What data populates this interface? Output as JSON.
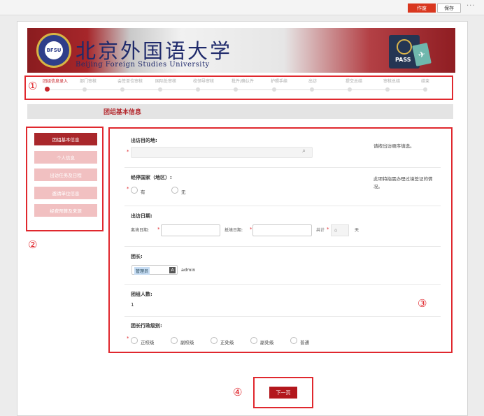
{
  "toolbar": {
    "draft": "作废",
    "save": "保存",
    "more": "···"
  },
  "banner": {
    "name_cn": "北京外国语大学",
    "name_en": "Beijing Foreign Studies University",
    "seal_text": "BFSU",
    "passport_label": "PASS",
    "ticket_glyph": "✈"
  },
  "steps": [
    {
      "label": "团组信息录入",
      "active": true
    },
    {
      "label": "部门审核"
    },
    {
      "label": "会签单位审核"
    },
    {
      "label": "国际处审核"
    },
    {
      "label": "校领导审核"
    },
    {
      "label": "批件/确认件"
    },
    {
      "label": "护照手续"
    },
    {
      "label": "出访"
    },
    {
      "label": "提交总结"
    },
    {
      "label": "审核总结"
    },
    {
      "label": "结束"
    }
  ],
  "markers": {
    "m1": "①",
    "m2": "②",
    "m3": "③",
    "m4": "④"
  },
  "section_title": "团组基本信息",
  "sidebar": {
    "items": [
      {
        "label": "团组基本信息",
        "active": true
      },
      {
        "label": "个人信息"
      },
      {
        "label": "出访任务及日程"
      },
      {
        "label": "邀请单位信息"
      },
      {
        "label": "经费预算及来源"
      }
    ]
  },
  "form": {
    "destination": {
      "label": "出访目的地:",
      "hint": "请按出访顺序填选。",
      "search_icon": "⌕"
    },
    "transit": {
      "label": "经停国家（地区）:",
      "hint": "此项特指需办理过境签证的情况。",
      "options": [
        "有",
        "无"
      ]
    },
    "dates": {
      "label": "出访日期:",
      "depart_label": "离境日期:",
      "return_label": "抵境日期:",
      "total_label": "共计",
      "total_value": "0",
      "unit": "天"
    },
    "leader": {
      "label": "团长:",
      "name": "管理员",
      "id": "admin",
      "btn_glyph": "A"
    },
    "count": {
      "label": "团组人数:",
      "value": "1"
    },
    "rank": {
      "label": "团长行政级别:",
      "options": [
        "正校级",
        "副校级",
        "正处级",
        "副处级",
        "普通"
      ]
    }
  },
  "required_mark": "*",
  "next_button": "下一页"
}
